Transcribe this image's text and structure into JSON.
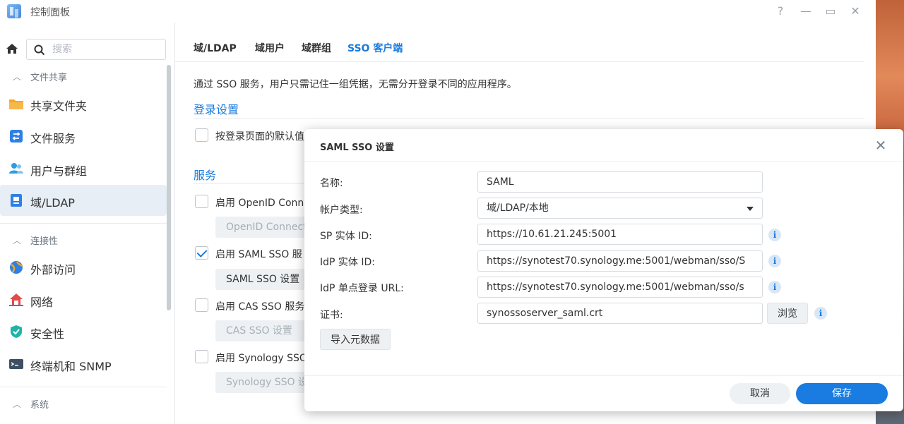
{
  "app": {
    "title": "控制面板",
    "icon": "control-panel-icon"
  },
  "window_controls": {
    "help": "?",
    "minimize": "—",
    "maximize": "▭",
    "close": "✕"
  },
  "sidebar": {
    "search_placeholder": "搜索",
    "groups": {
      "file_sharing": "文件共享",
      "connectivity": "连接性",
      "system": "系统"
    },
    "items": [
      {
        "label": "共享文件夹",
        "icon": "folder-icon"
      },
      {
        "label": "文件服务",
        "icon": "file-services-icon"
      },
      {
        "label": "用户与群组",
        "icon": "users-icon"
      },
      {
        "label": "域/LDAP",
        "icon": "domain-ldap-icon"
      },
      {
        "label": "外部访问",
        "icon": "external-access-icon"
      },
      {
        "label": "网络",
        "icon": "network-icon"
      },
      {
        "label": "安全性",
        "icon": "security-icon"
      },
      {
        "label": "终端机和 SNMP",
        "icon": "terminal-icon"
      }
    ],
    "active_item": "域/LDAP"
  },
  "tabs": [
    "域/LDAP",
    "域用户",
    "域群组",
    "SSO 客户端"
  ],
  "active_tab": "SSO 客户端",
  "main": {
    "description": "通过 SSO 服务，用户只需记住一组凭据，无需分开登录不同的应用程序。",
    "login_settings_title": "登录设置",
    "login_default_checkbox": "按登录页面的默认值",
    "services_title": "服务",
    "services": [
      {
        "checkbox": "启用 OpenID Conn",
        "checked": false,
        "button": "OpenID Connect",
        "button_enabled": false
      },
      {
        "checkbox": "启用 SAML SSO 服",
        "checked": true,
        "button": "SAML SSO 设置",
        "button_enabled": true
      },
      {
        "checkbox": "启用 CAS SSO 服务",
        "checked": false,
        "button": "CAS SSO 设置",
        "button_enabled": false
      },
      {
        "checkbox": "启用 Synology SSO",
        "checked": false,
        "button": "Synology SSO 设",
        "button_enabled": false
      }
    ]
  },
  "dialog": {
    "title": "SAML SSO 设置",
    "fields": {
      "name": {
        "label": "名称:",
        "value": "SAML"
      },
      "account_type": {
        "label": "帐户类型:",
        "value": "域/LDAP/本地"
      },
      "sp_entity_id": {
        "label": "SP 实体 ID:",
        "value": "https://10.61.21.245:5001"
      },
      "idp_entity_id": {
        "label": "IdP 实体 ID:",
        "value": "https://synotest70.synology.me:5001/webman/sso/S"
      },
      "idp_sso_url": {
        "label": "IdP 单点登录 URL:",
        "value": "https://synotest70.synology.me:5001/webman/sso/s"
      },
      "certificate": {
        "label": "证书:",
        "value": "synossoserver_saml.crt"
      }
    },
    "browse_button": "浏览",
    "import_metadata_button": "导入元数据",
    "cancel_button": "取消",
    "save_button": "保存"
  },
  "colors": {
    "accent": "#1a7be0",
    "sidebar_active_bg": "#e7eef6"
  }
}
